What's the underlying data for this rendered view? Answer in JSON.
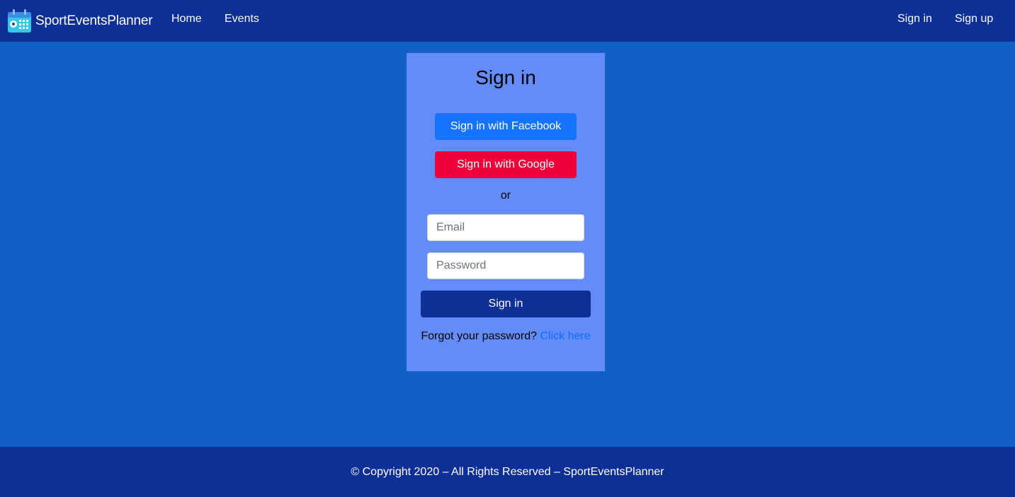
{
  "navbar": {
    "brand": "SportEventsPlanner",
    "brand_icon": "calendar-icon",
    "links": {
      "home": "Home",
      "events": "Events",
      "sign_in": "Sign in",
      "sign_up": "Sign up"
    }
  },
  "signin_card": {
    "title": "Sign in",
    "facebook_button": "Sign in with Facebook",
    "google_button": "Sign in with Google",
    "divider_text": "or",
    "email_placeholder": "Email",
    "password_placeholder": "Password",
    "submit_button": "Sign in",
    "forgot_text": "Forgot your password?",
    "forgot_link": "Click here"
  },
  "footer": {
    "text": "© Copyright 2020 – All Rights Reserved – SportEventsPlanner"
  },
  "colors": {
    "navbar_bg": "#0e2f96",
    "page_bg": "#1160c6",
    "card_bg": "#648cf9",
    "facebook": "#1573ff",
    "google": "#ef0039",
    "link": "#0d6efd"
  }
}
